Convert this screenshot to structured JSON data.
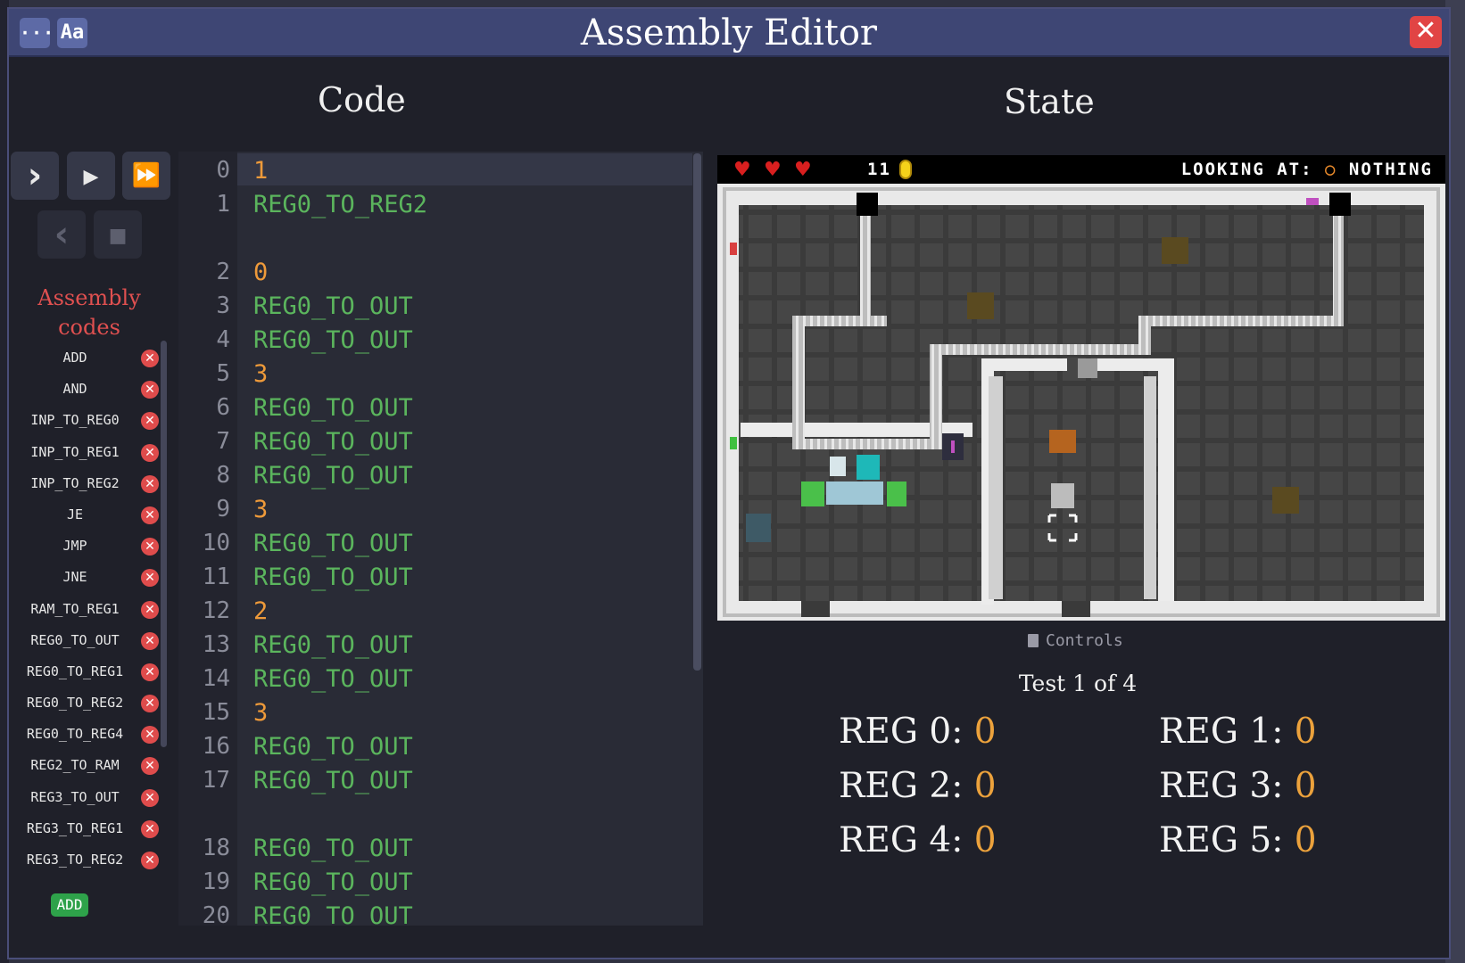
{
  "window": {
    "title": "Assembly Editor"
  },
  "toolbar": {
    "menu_glyph": "···",
    "font_glyph": "Aa",
    "close_glyph": "✕"
  },
  "panels": {
    "code_title": "Code",
    "state_title": "State"
  },
  "controls": {
    "step_glyph": "›",
    "run_glyph": "▶",
    "fast_glyph": "⏩",
    "back_glyph": "‹",
    "stop_glyph": "■"
  },
  "assembly_codes": {
    "title": "Assembly codes",
    "items": [
      "ADD",
      "AND",
      "INP_TO_REG0",
      "INP_TO_REG1",
      "INP_TO_REG2",
      "JE",
      "JMP",
      "JNE",
      "RAM_TO_REG1",
      "REG0_TO_OUT",
      "REG0_TO_REG1",
      "REG0_TO_REG2",
      "REG0_TO_REG4",
      "REG2_TO_RAM",
      "REG3_TO_OUT",
      "REG3_TO_REG1",
      "REG3_TO_REG2"
    ],
    "delete_glyph": "✕",
    "add_label": "ADD"
  },
  "code": {
    "lines": [
      {
        "num": "0",
        "text": "1",
        "kind": "num"
      },
      {
        "num": "1",
        "text": "REG0_TO_REG2",
        "kind": "instr"
      },
      {
        "num": "",
        "text": "",
        "kind": "blank"
      },
      {
        "num": "2",
        "text": "0",
        "kind": "num"
      },
      {
        "num": "3",
        "text": "REG0_TO_OUT",
        "kind": "instr"
      },
      {
        "num": "4",
        "text": "REG0_TO_OUT",
        "kind": "instr"
      },
      {
        "num": "5",
        "text": "3",
        "kind": "num"
      },
      {
        "num": "6",
        "text": "REG0_TO_OUT",
        "kind": "instr"
      },
      {
        "num": "7",
        "text": "REG0_TO_OUT",
        "kind": "instr"
      },
      {
        "num": "8",
        "text": "REG0_TO_OUT",
        "kind": "instr"
      },
      {
        "num": "9",
        "text": "3",
        "kind": "num"
      },
      {
        "num": "10",
        "text": "REG0_TO_OUT",
        "kind": "instr"
      },
      {
        "num": "11",
        "text": "REG0_TO_OUT",
        "kind": "instr"
      },
      {
        "num": "12",
        "text": "2",
        "kind": "num"
      },
      {
        "num": "13",
        "text": "REG0_TO_OUT",
        "kind": "instr"
      },
      {
        "num": "14",
        "text": "REG0_TO_OUT",
        "kind": "instr"
      },
      {
        "num": "15",
        "text": "3",
        "kind": "num"
      },
      {
        "num": "16",
        "text": "REG0_TO_OUT",
        "kind": "instr"
      },
      {
        "num": "17",
        "text": "REG0_TO_OUT",
        "kind": "instr"
      },
      {
        "num": "",
        "text": "",
        "kind": "blank"
      },
      {
        "num": "18",
        "text": "REG0_TO_OUT",
        "kind": "instr"
      },
      {
        "num": "19",
        "text": "REG0_TO_OUT",
        "kind": "instr"
      },
      {
        "num": "20",
        "text": "REG0_TO_OUT",
        "kind": "instr"
      }
    ]
  },
  "game": {
    "hud": {
      "hearts": 3,
      "heart_glyph": "♥",
      "coins": "11",
      "looking_prefix": "LOOKING AT:",
      "looking_dot": "○",
      "looking_value": "NOTHING"
    }
  },
  "state": {
    "controls_label": "Controls",
    "test_status": "Test 1 of 4",
    "registers": [
      {
        "label": "REG 0:",
        "value": "0"
      },
      {
        "label": "REG 1:",
        "value": "0"
      },
      {
        "label": "REG 2:",
        "value": "0"
      },
      {
        "label": "REG 3:",
        "value": "0"
      },
      {
        "label": "REG 4:",
        "value": "0"
      },
      {
        "label": "REG 5:",
        "value": "0"
      }
    ]
  },
  "colors": {
    "window_bg": "#1f2029",
    "titlebar": "#3e4674",
    "instruction": "#5bb55d",
    "number": "#ee9a3a",
    "close": "#e14444",
    "heading_red": "#e05050"
  }
}
